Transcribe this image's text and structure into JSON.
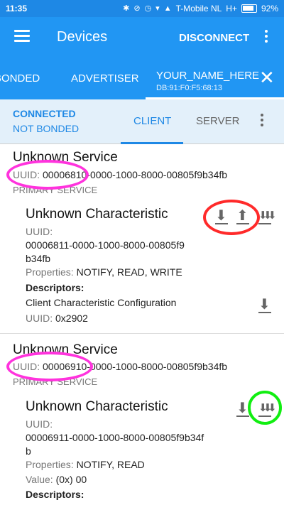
{
  "status": {
    "time": "11:35",
    "carrier": "T-Mobile NL",
    "network": "H+",
    "battery": "92%"
  },
  "appbar": {
    "title": "Devices",
    "action": "DISCONNECT"
  },
  "tabs": {
    "bonded": "BONDED",
    "advertiser": "ADVERTISER",
    "device_name": "YOUR_NAME_HERE",
    "device_address": "DB:91:F0:F5:68:13"
  },
  "connection": {
    "state": "CONNECTED",
    "bond": "NOT BONDED",
    "client_tab": "CLIENT",
    "server_tab": "SERVER"
  },
  "services": [
    {
      "title": "Unknown Service",
      "uuid_label": "UUID:",
      "uuid": "00006810-0000-1000-8000-00805f9b34fb",
      "type": "PRIMARY SERVICE",
      "characteristic": {
        "title": "Unknown Characteristic",
        "uuid_label": "UUID:",
        "uuid_line1": "00006811-0000-1000-8000-00805f9",
        "uuid_line2": "b34fb",
        "properties_label": "Properties:",
        "properties": "NOTIFY, READ, WRITE",
        "descriptors_label": "Descriptors:",
        "descriptor_name": "Client Characteristic Configuration",
        "descriptor_uuid_label": "UUID:",
        "descriptor_uuid": "0x2902"
      }
    },
    {
      "title": "Unknown Service",
      "uuid_label": "UUID:",
      "uuid": "00006910-0000-1000-8000-00805f9b34fb",
      "type": "PRIMARY SERVICE",
      "characteristic": {
        "title": "Unknown Characteristic",
        "uuid_label": "UUID:",
        "uuid_line1": "00006911-0000-1000-8000-00805f9b34f",
        "uuid_line2": "b",
        "properties_label": "Properties:",
        "properties": "NOTIFY, READ",
        "value_label": "Value:",
        "value": "(0x) 00",
        "descriptors_label": "Descriptors:"
      }
    }
  ],
  "colors": {
    "primary": "#2196f3",
    "status": "#1e88e5",
    "annotation_magenta": "#ff33dd",
    "annotation_red": "#ff2a2a",
    "annotation_green": "#11ee11"
  },
  "icons": [
    "menu-icon",
    "more-vert-icon",
    "close-icon",
    "read-icon",
    "write-icon",
    "notify-icon"
  ]
}
